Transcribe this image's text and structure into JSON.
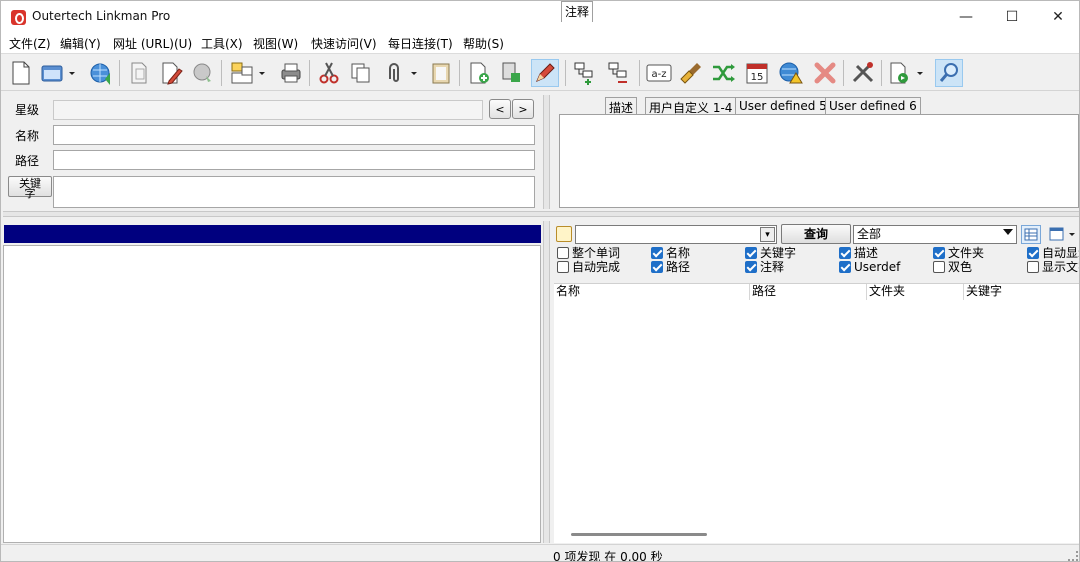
{
  "window": {
    "title": "Outertech Linkman Pro",
    "minimize": "—",
    "maximize": "☐",
    "close": "✕"
  },
  "menu": [
    {
      "label": "文件(Z)"
    },
    {
      "label": "编辑(Y)"
    },
    {
      "label": "网址 (URL)(U)"
    },
    {
      "label": "工具(X)"
    },
    {
      "label": "视图(W)"
    },
    {
      "label": "快速访问(V)"
    },
    {
      "label": "每日连接(T)"
    },
    {
      "label": "帮助(S)"
    }
  ],
  "toolbar_icons": [
    "new-file-icon",
    "window-icon",
    "globe-person-icon",
    "copy-page-icon",
    "edit-page-icon",
    "globe-arrow-icon",
    "layout-icon",
    "printer-icon",
    "scissors-icon",
    "copy-icon",
    "paperclip-icon",
    "clipboard-icon",
    "new-link-icon",
    "add-item-icon",
    "pencil-icon",
    "add-folder-icon",
    "remove-folder-icon",
    "sort-az-icon",
    "broom-icon",
    "shuffle-icon",
    "calendar-icon",
    "globe-warning-icon",
    "delete-icon",
    "tools-icon",
    "export-icon",
    "search-icon"
  ],
  "calendar_day": "15",
  "sort_label": "a-z",
  "details": {
    "rating_label": "星级",
    "name_label": "名称",
    "path_label": "路径",
    "keyword_button": "关键字",
    "prev": "<",
    "next": ">"
  },
  "tabs": [
    {
      "label": "注释",
      "active": true
    },
    {
      "label": "描述"
    },
    {
      "label": "用户自定义 1-4"
    },
    {
      "label": "User defined 5"
    },
    {
      "label": "User defined 6"
    }
  ],
  "search": {
    "query_button": "查询",
    "scope_value": "全部",
    "input_value": ""
  },
  "options_row1": [
    {
      "label": "整个单词",
      "checked": false
    },
    {
      "label": "名称",
      "checked": true
    },
    {
      "label": "关键字",
      "checked": true
    },
    {
      "label": "描述",
      "checked": true
    },
    {
      "label": "文件夹",
      "checked": true
    },
    {
      "label": "自动显示",
      "checked": true
    }
  ],
  "options_row2": [
    {
      "label": "自动完成",
      "checked": false
    },
    {
      "label": "路径",
      "checked": true
    },
    {
      "label": "注释",
      "checked": true
    },
    {
      "label": "Userdef",
      "checked": true
    },
    {
      "label": "双色",
      "checked": false
    },
    {
      "label": "显示文字",
      "checked": false
    }
  ],
  "columns": [
    "名称",
    "路径",
    "文件夹",
    "关键字"
  ],
  "status": "0 项发现 在 0,00 秒",
  "colors": {
    "accent": "#1f6fc8",
    "tree_header": "#00007f"
  }
}
